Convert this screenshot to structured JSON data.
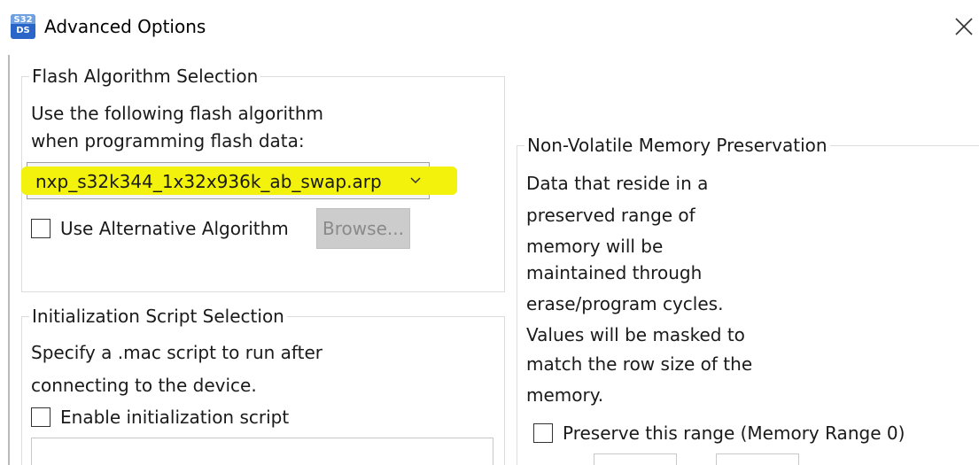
{
  "window": {
    "title": "Advanced Options",
    "app_icon_text": "S32\nDS",
    "app_icon": "s32ds-icon",
    "close_icon": "close-icon"
  },
  "flash_algorithm": {
    "legend": "Flash Algorithm Selection",
    "description_line1": "Use the following flash algorithm",
    "description_line2": "when programming flash data:",
    "selected_algorithm": "nxp_s32k344_1x32x936k_ab_swap.arp",
    "highlight_color": "#f2f20c",
    "use_alternative_label": "Use Alternative Algorithm",
    "use_alternative_checked": false,
    "browse_label": "Browse...",
    "browse_enabled": false
  },
  "init_script": {
    "legend": "Initialization Script Selection",
    "description_line1": "Specify a .mac script to run after",
    "description_line2": "connecting to the device.",
    "enable_label": "Enable initialization script",
    "enable_checked": false
  },
  "nvm_preservation": {
    "legend": "Non-Volatile Memory Preservation",
    "description_lines": [
      "Data that reside in a",
      "preserved range of",
      "memory will be",
      "maintained through",
      "erase/program cycles.",
      "Values will be masked to",
      "match the row size of the",
      "memory."
    ],
    "preserve_label": "Preserve this range (Memory Range 0)",
    "preserve_checked": false
  }
}
